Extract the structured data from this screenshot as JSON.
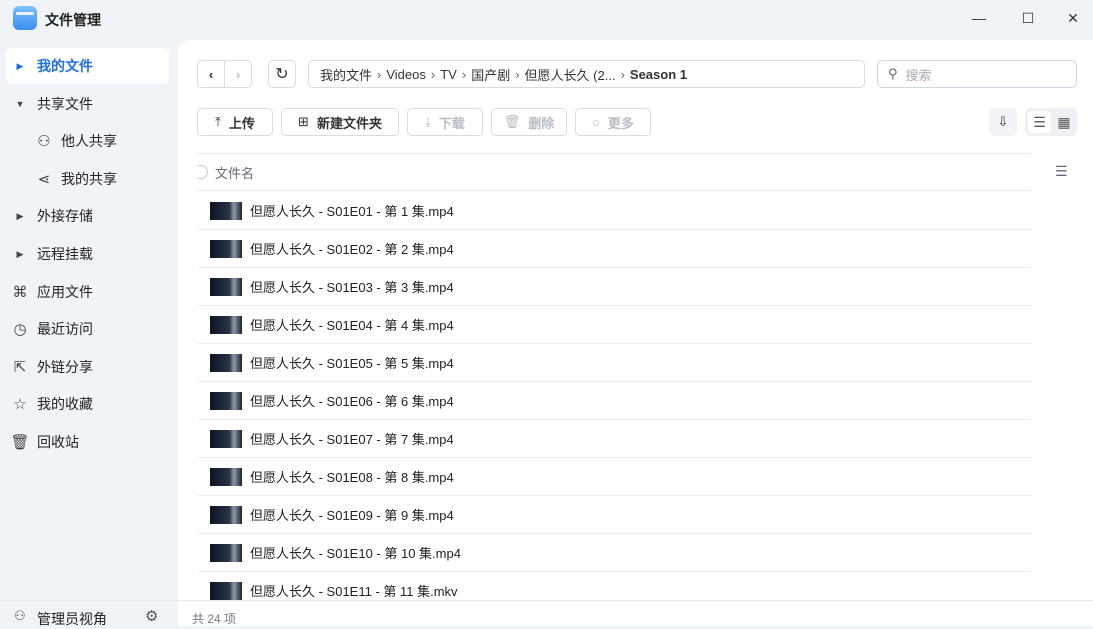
{
  "app": {
    "title": "文件管理"
  },
  "window": {
    "minimize": "—",
    "maximize": "☐",
    "close": "✕"
  },
  "sidebar": {
    "items": [
      {
        "label": "我的文件",
        "icon": "caret-right-icon",
        "active": true
      },
      {
        "label": "共享文件",
        "icon": "caret-down-icon"
      },
      {
        "label": "他人共享",
        "icon": "user-icon",
        "sub": true
      },
      {
        "label": "我的共享",
        "icon": "share-icon",
        "sub": true
      },
      {
        "label": "外接存储",
        "icon": "caret-right-icon"
      },
      {
        "label": "远程挂载",
        "icon": "caret-right-icon"
      },
      {
        "label": "应用文件",
        "icon": "apps-icon"
      },
      {
        "label": "最近访问",
        "icon": "clock-icon"
      },
      {
        "label": "外链分享",
        "icon": "external-share-icon"
      },
      {
        "label": "我的收藏",
        "icon": "star-icon"
      },
      {
        "label": "回收站",
        "icon": "trash-icon"
      }
    ],
    "footer": {
      "label": "管理员视角"
    }
  },
  "breadcrumb": [
    "我的文件",
    "Videos",
    "TV",
    "国产剧",
    "但愿人长久 (2...",
    "Season 1"
  ],
  "search": {
    "placeholder": "搜索"
  },
  "toolbar": {
    "upload": "上传",
    "new_folder": "新建文件夹",
    "download": "下载",
    "delete": "删除",
    "more": "更多"
  },
  "table": {
    "header": "文件名",
    "rows": [
      "但愿人长久 - S01E01 - 第 1 集.mp4",
      "但愿人长久 - S01E02 - 第 2 集.mp4",
      "但愿人长久 - S01E03 - 第 3 集.mp4",
      "但愿人长久 - S01E04 - 第 4 集.mp4",
      "但愿人长久 - S01E05 - 第 5 集.mp4",
      "但愿人长久 - S01E06 - 第 6 集.mp4",
      "但愿人长久 - S01E07 - 第 7 集.mp4",
      "但愿人长久 - S01E08 - 第 8 集.mp4",
      "但愿人长久 - S01E09 - 第 9 集.mp4",
      "但愿人长久 - S01E10 - 第 10 集.mp4",
      "但愿人长久 - S01E11 - 第 11 集.mkv"
    ]
  },
  "status": {
    "count": "共 24 项"
  }
}
